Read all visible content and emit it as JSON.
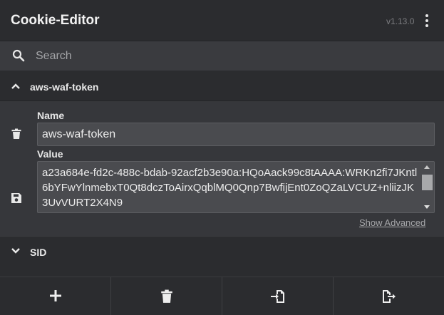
{
  "app": {
    "title": "Cookie-Editor",
    "version": "v1.13.0"
  },
  "search": {
    "placeholder": "Search",
    "value": ""
  },
  "cookies": [
    {
      "name": "aws-waf-token",
      "expanded": true,
      "name_label": "Name",
      "name_value": "aws-waf-token",
      "value_label": "Value",
      "value": "a23a684e-fd2c-488c-bdab-92acf2b3e90a:HQoAack99c8tAAAA:WRKn2fi7JKntl6bYFwYlnmebxT0Qt8dczToAirxQqblMQ0Qnp7BwfijEnt0ZoQZaLVCUZ+nliizJK3UvVURT2X4N9",
      "show_advanced_label": "Show Advanced"
    },
    {
      "name": "SID",
      "expanded": false
    }
  ],
  "icons": {
    "menu": "vertical-dots-icon",
    "search": "search-icon",
    "collapse": "chevron-up-icon",
    "expand": "chevron-down-icon",
    "delete": "trash-icon",
    "save": "save-disk-icon",
    "add": "plus-icon",
    "delete_all": "trash-icon",
    "import": "import-icon",
    "export": "export-icon"
  },
  "colors": {
    "background": "#2b2c2f",
    "panel": "#36373b",
    "input": "#4a4b4f",
    "text": "#e6e6e6",
    "muted": "#7c7d80"
  }
}
